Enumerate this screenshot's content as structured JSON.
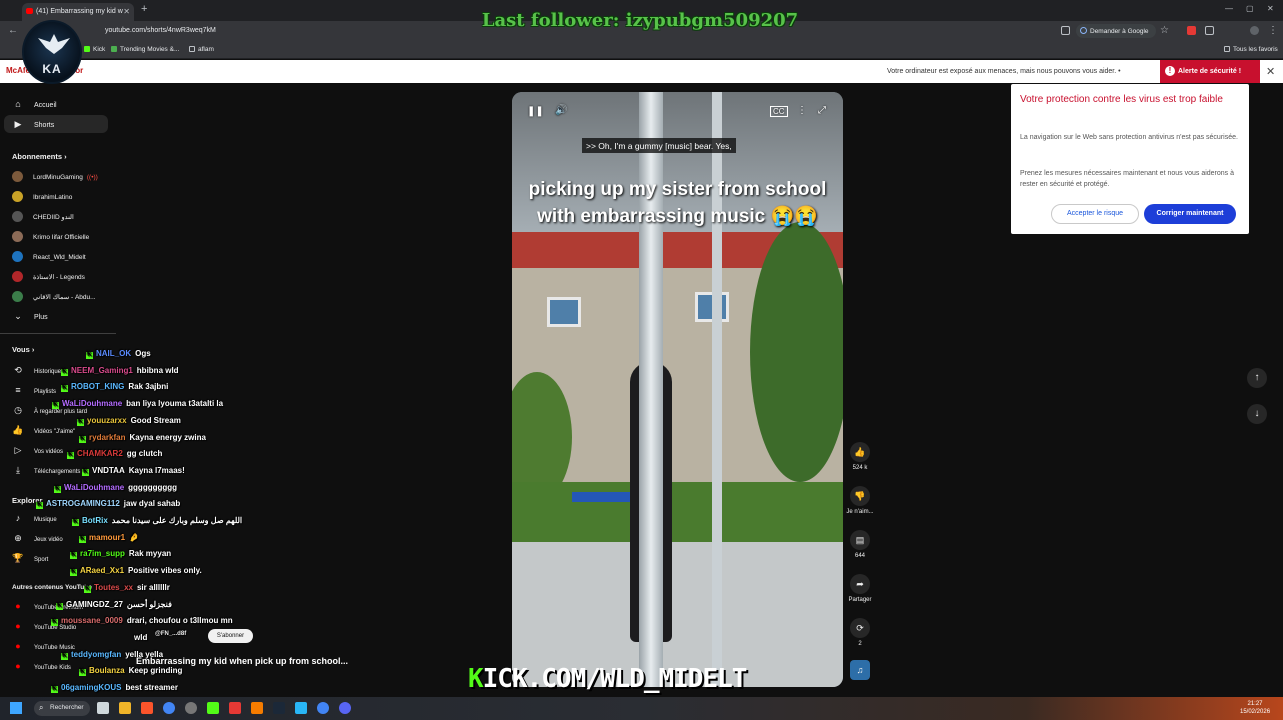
{
  "browser": {
    "tab_title": "(41) Embarrassing my kid w",
    "url": "youtube.com/shorts/4nwR3weq7kM",
    "google_button": "Demander à Google",
    "bookmarks": [
      "Kick",
      "Trending Movies &...",
      "aflam"
    ],
    "all_favorites": "Tous les favoris"
  },
  "overlay": {
    "last_follower": "Last follower: izypubgm509207",
    "kick_url": "KICK.COM/WLD_MIDELT",
    "logo_text": "KA"
  },
  "security_bar": {
    "brand": "McAfee WebAdvisor",
    "message": "Votre ordinateur est exposé aux menaces, mais nous pouvons vous aider. •",
    "alert": "Alerte de sécurité !"
  },
  "sidebar": {
    "main": [
      {
        "label": "Accueil",
        "icon": "home-icon"
      },
      {
        "label": "Shorts",
        "icon": "shorts-icon"
      }
    ],
    "subscriptions_header": "Abonnements",
    "subscriptions": [
      {
        "name": "LordMinuGaming",
        "color": "#7c5a3c",
        "live": true
      },
      {
        "name": "IbrahimLatino",
        "color": "#c9a227",
        "live": false
      },
      {
        "name": "CHEDIID الندو",
        "color": "#555555",
        "live": false
      },
      {
        "name": "Krimo Iifar Officielle",
        "color": "#8c6b57",
        "live": false
      },
      {
        "name": "React_Wld_Midelt",
        "color": "#1e73be",
        "live": false
      },
      {
        "name": "الاستاذة - Legends",
        "color": "#b1272a",
        "live": false
      },
      {
        "name": "سماك الاقاني - Abdu...",
        "color": "#3b7d4a",
        "live": false
      }
    ],
    "more": "Plus",
    "you_header": "Vous",
    "you_items": [
      {
        "label": "Historique",
        "icon": "history-icon"
      },
      {
        "label": "Playlists",
        "icon": "playlist-icon"
      },
      {
        "label": "À regarder plus tard",
        "icon": "clock-icon"
      },
      {
        "label": "Vidéos \"J'aime\"",
        "icon": "thumb-up-icon"
      },
      {
        "label": "Vos vidéos",
        "icon": "video-icon"
      },
      {
        "label": "Téléchargements",
        "icon": "download-icon"
      }
    ],
    "explore_header": "Explorer",
    "explore_items": [
      {
        "label": "Musique",
        "icon": "music-icon"
      },
      {
        "label": "Jeux vidéo",
        "icon": "gamepad-icon"
      },
      {
        "label": "Sport",
        "icon": "trophy-icon"
      }
    ],
    "other_header": "Autres contenus YouTube",
    "other_items": [
      "YouTube Premium",
      "YouTube Studio",
      "YouTube Music",
      "YouTube Kids"
    ]
  },
  "chat": [
    {
      "user": "NAIL_OK",
      "msg": "Ogs",
      "color": "#5b8cff"
    },
    {
      "user": "NEEM_Gaming1",
      "msg": "hbibna wld",
      "color": "#d94b8c"
    },
    {
      "user": "ROBOT_KING",
      "msg": "Rak 3ajbni",
      "color": "#5ab8ff"
    },
    {
      "user": "WaLiDouhmane",
      "msg": "ban liya lyouma t3atalti la",
      "color": "#b46cff"
    },
    {
      "user": "youuzarxx",
      "msg": "Good Stream",
      "color": "#e8c43a"
    },
    {
      "user": "rydarkfan",
      "msg": "Kayna energy zwina",
      "color": "#e07b39"
    },
    {
      "user": "CHAMKAR2",
      "msg": "gg clutch",
      "color": "#d93a3a"
    },
    {
      "user": "VNDTAA",
      "msg": "Kayna l7maas!",
      "color": "#ffffff"
    },
    {
      "user": "WaLiDouhmane",
      "msg": "gggggggggg",
      "color": "#b46cff"
    },
    {
      "user": "ASTROGAMING112",
      "msg": "jaw dyal sahab",
      "color": "#9fd7ff"
    },
    {
      "user": "BotRix",
      "msg": "اللهم صل وسلم وبارك على سيدنا محمد",
      "color": "#79e0ff"
    },
    {
      "user": "mamour1",
      "msg": "🤌",
      "color": "#ff9a3c"
    },
    {
      "user": "ra7im_supp",
      "msg": "Rak myyan",
      "color": "#53fc18"
    },
    {
      "user": "ARaed_Xx1",
      "msg": "Positive vibes only.",
      "color": "#f5d442"
    },
    {
      "user": "Toutes_xx",
      "msg": "sir allllllr",
      "color": "#d94b4b"
    },
    {
      "user": "GAMINGDZ_27",
      "msg": "فنجزلو أحسن",
      "color": "#ffffff"
    },
    {
      "user": "moussane_0009",
      "msg": "drari, choufou o t3llmou mn",
      "color": "#d96c6c"
    },
    {
      "user": "",
      "msg": "wld",
      "color": "#ffffff"
    },
    {
      "user": "teddyomgfan",
      "msg": "yella yella",
      "color": "#5ab8ff"
    },
    {
      "user": "Boulanza",
      "msg": "Keep grinding",
      "color": "#f5d442"
    },
    {
      "user": "06gamingKOUS",
      "msg": "best streamer",
      "color": "#5ab8ff"
    }
  ],
  "video": {
    "caption": ">> Oh, I'm a gummy [music] bear. Yes,",
    "overlay_text": "picking up my sister from school with embarrassing music 😭😭",
    "title": "Embarrassing my kid when pick up from school...",
    "channel_handle": "@FN_...d8f",
    "subscribe": "S'abonner",
    "likes": "524 k",
    "dislike_label": "Je n'aim...",
    "comments": "644",
    "share": "Partager",
    "remix": "2"
  },
  "popup": {
    "title": "Votre protection contre les virus est trop faible",
    "p1": "La navigation sur le Web sans protection antivirus n'est pas sécurisée.",
    "p2": "Prenez les mesures nécessaires maintenant et nous vous aiderons à rester en sécurité et protégé.",
    "accept": "Accepter le risque",
    "fix": "Corriger maintenant"
  },
  "taskbar": {
    "search": "Rechercher",
    "time": "21:27",
    "date": "15/02/2026"
  }
}
